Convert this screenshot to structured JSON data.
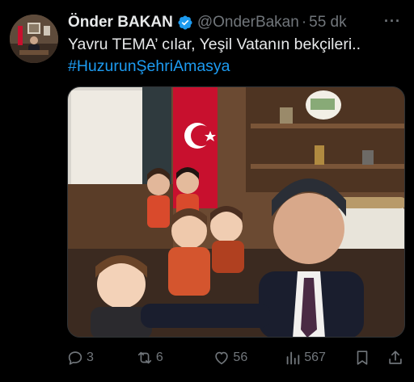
{
  "tweet": {
    "display_name": "Önder BAKAN",
    "handle": "@OnderBakan",
    "separator": "·",
    "time": "55 dk",
    "more": "···",
    "text": "Yavru TEMA’ cılar,  Yeşil Vatanın bekçileri..",
    "hashtag": "#HuzurunŞehriAmasya"
  },
  "actions": {
    "replies": "3",
    "retweets": "6",
    "likes": "56",
    "views": "567"
  },
  "icons": {
    "verified": "verified-badge-icon",
    "reply": "reply-icon",
    "retweet": "retweet-icon",
    "like": "heart-icon",
    "views": "views-chart-icon",
    "bookmark": "bookmark-icon",
    "share": "share-icon"
  },
  "colors": {
    "background": "#000000",
    "text": "#e7e9ea",
    "muted": "#71767b",
    "accent": "#1d9bf0"
  }
}
